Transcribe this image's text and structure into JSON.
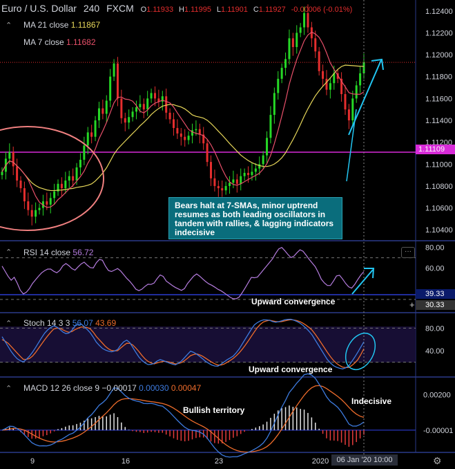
{
  "header": {
    "symbol": "Euro / U.S. Dollar",
    "interval": "240",
    "source": "FXCM",
    "o_label": "O",
    "o_value": "1.11933",
    "h_label": "H",
    "h_value": "1.11995",
    "l_label": "L",
    "l_value": "1.11901",
    "c_label": "C",
    "c_value": "1.11927",
    "change": "-0.00006 (-0.01%)"
  },
  "legends": {
    "ma21_label": "MA 21 close",
    "ma21_value": "1.11867",
    "ma7_label": "MA 7 close",
    "ma7_value": "1.11682",
    "rsi_label": "RSI 14 close",
    "rsi_value": "56.72",
    "stoch_label": "Stoch 14 3 3",
    "stoch_k": "56.07",
    "stoch_d": "43.69",
    "macd_label": "MACD 12 26 close 9",
    "macd_hist": "−0.00017",
    "macd_line": "0.00030",
    "macd_signal": "0.00047"
  },
  "annotations": {
    "callout": "Bears halt at 7-SMAs, minor uptrend resumes as both leading oscillators in tandem with rallies, & lagging indicators indecisive",
    "rsi_note": "Upward convergence",
    "stoch_note": "Upward convergence",
    "macd_note1": "Bullish territory",
    "macd_note2": "Indecisive"
  },
  "price_axis": {
    "ticks": [
      "1.12400",
      "1.12200",
      "1.12000",
      "1.11800",
      "1.11600",
      "1.11400",
      "1.11200",
      "1.11000",
      "1.10800",
      "1.10600",
      "1.10400"
    ],
    "current_price": "1.11109"
  },
  "rsi_axis": {
    "ticks": [
      "80.00",
      "60.00"
    ],
    "badge1": "39.33",
    "badge2": "30.33"
  },
  "stoch_axis": {
    "ticks": [
      "80.00",
      "40.00"
    ]
  },
  "macd_axis": {
    "ticks": [
      "0.00200",
      "-0.00001"
    ]
  },
  "time_axis": {
    "ticks": [
      "9",
      "16",
      "23",
      "2020"
    ],
    "cursor_label": "06 Jan '20   10:00"
  },
  "colors": {
    "up": "#26d926",
    "down": "#e62e2e",
    "ma21": "#e8d85a",
    "ma7": "#e8506a",
    "rsi": "#b67de0",
    "stoch_k": "#3d7bdf",
    "stoch_d": "#ee6c2b",
    "macd": "#3d7bdf",
    "signal": "#ee6c2b",
    "arrow": "#22c6f2",
    "support": "#d82bd8",
    "ellipse": "#f08080",
    "accent_label": "#d82bd8"
  },
  "chart_data": {
    "type": "candlestick",
    "title": "Euro / U.S. Dollar 240 FXCM",
    "ylim": [
      1.103,
      1.125
    ],
    "x_ticks": [
      "9",
      "16",
      "23",
      "2020"
    ],
    "close_prices": [
      1.1093,
      1.1105,
      1.1111,
      1.1098,
      1.1085,
      1.1078,
      1.1066,
      1.1058,
      1.1052,
      1.1058,
      1.106,
      1.1066,
      1.1063,
      1.1069,
      1.1075,
      1.1082,
      1.1078,
      1.1085,
      1.1089,
      1.1085,
      1.1097,
      1.1104,
      1.1117,
      1.1129,
      1.1125,
      1.114,
      1.1151,
      1.1146,
      1.1158,
      1.118,
      1.1192,
      1.116,
      1.1142,
      1.1138,
      1.1143,
      1.1148,
      1.1152,
      1.1155,
      1.115,
      1.116,
      1.1165,
      1.116,
      1.1157,
      1.1162,
      1.1147,
      1.1141,
      1.1133,
      1.1128,
      1.1125,
      1.1122,
      1.1126,
      1.1131,
      1.1132,
      1.1127,
      1.1119,
      1.1102,
      1.1087,
      1.108,
      1.1078,
      1.1076,
      1.108,
      1.1083,
      1.1086,
      1.1082,
      1.1089,
      1.1092,
      1.109,
      1.1093,
      1.1096,
      1.11,
      1.1108,
      1.1124,
      1.1145,
      1.1165,
      1.1178,
      1.1188,
      1.1196,
      1.1215,
      1.1207,
      1.122,
      1.1225,
      1.1238,
      1.1225,
      1.1215,
      1.1203,
      1.1185,
      1.1178,
      1.1168,
      1.1174,
      1.1183,
      1.1178,
      1.1164,
      1.115,
      1.114,
      1.116,
      1.1172,
      1.1183,
      1.1193
    ],
    "ma21_last": 1.11867,
    "ma7_last": 1.11682,
    "horizontal_levels": [
      1.11109,
      1.1193
    ],
    "rsi": {
      "ylim": [
        20,
        85
      ],
      "levels": [
        70,
        30
      ],
      "values": [
        62,
        55,
        48,
        52,
        40,
        35,
        38,
        45,
        50,
        55,
        58,
        60,
        57,
        55,
        62,
        65,
        60,
        58,
        63,
        66,
        62,
        59,
        66,
        70,
        62,
        56,
        58,
        60,
        55,
        50,
        46,
        40,
        38,
        42,
        45,
        44,
        50,
        55,
        48,
        45,
        42,
        40,
        38,
        45,
        50,
        55,
        52,
        48,
        45,
        43,
        40,
        38,
        35,
        32,
        30,
        32,
        38,
        45,
        52,
        50,
        55,
        60,
        65,
        70,
        78,
        80,
        75,
        70,
        72,
        78,
        76,
        70,
        65,
        60,
        50,
        45,
        42,
        48,
        55,
        50,
        44,
        40,
        45,
        52,
        56.72
      ]
    },
    "stoch": {
      "ylim": [
        0,
        100
      ],
      "levels": [
        80,
        20
      ],
      "k": [
        65,
        50,
        35,
        25,
        20,
        28,
        40,
        55,
        70,
        80,
        85,
        78,
        70,
        72,
        85,
        88,
        80,
        70,
        55,
        45,
        40,
        38,
        42,
        55,
        60,
        45,
        30,
        20,
        15,
        18,
        25,
        22,
        18,
        15,
        20,
        30,
        40,
        35,
        28,
        20,
        15,
        12,
        18,
        25,
        30,
        40,
        55,
        70,
        85,
        92,
        95,
        94,
        90,
        92,
        95,
        96,
        93,
        88,
        80,
        70,
        55,
        40,
        25,
        15,
        10,
        8,
        12,
        25,
        40,
        56.07
      ],
      "d": [
        60,
        55,
        45,
        35,
        25,
        25,
        32,
        45,
        58,
        70,
        80,
        80,
        75,
        72,
        78,
        82,
        82,
        78,
        65,
        55,
        45,
        40,
        40,
        48,
        55,
        50,
        40,
        28,
        20,
        17,
        20,
        22,
        20,
        17,
        18,
        24,
        32,
        35,
        32,
        26,
        20,
        15,
        15,
        20,
        26,
        34,
        45,
        58,
        72,
        85,
        92,
        94,
        92,
        91,
        93,
        95,
        94,
        91,
        85,
        78,
        66,
        52,
        38,
        25,
        16,
        11,
        10,
        16,
        26,
        43.69
      ]
    },
    "macd": {
      "ylim": [
        -0.0011,
        0.0028
      ],
      "macd_last": 0.0003,
      "signal_last": 0.00047,
      "hist_last": -0.00017
    }
  }
}
